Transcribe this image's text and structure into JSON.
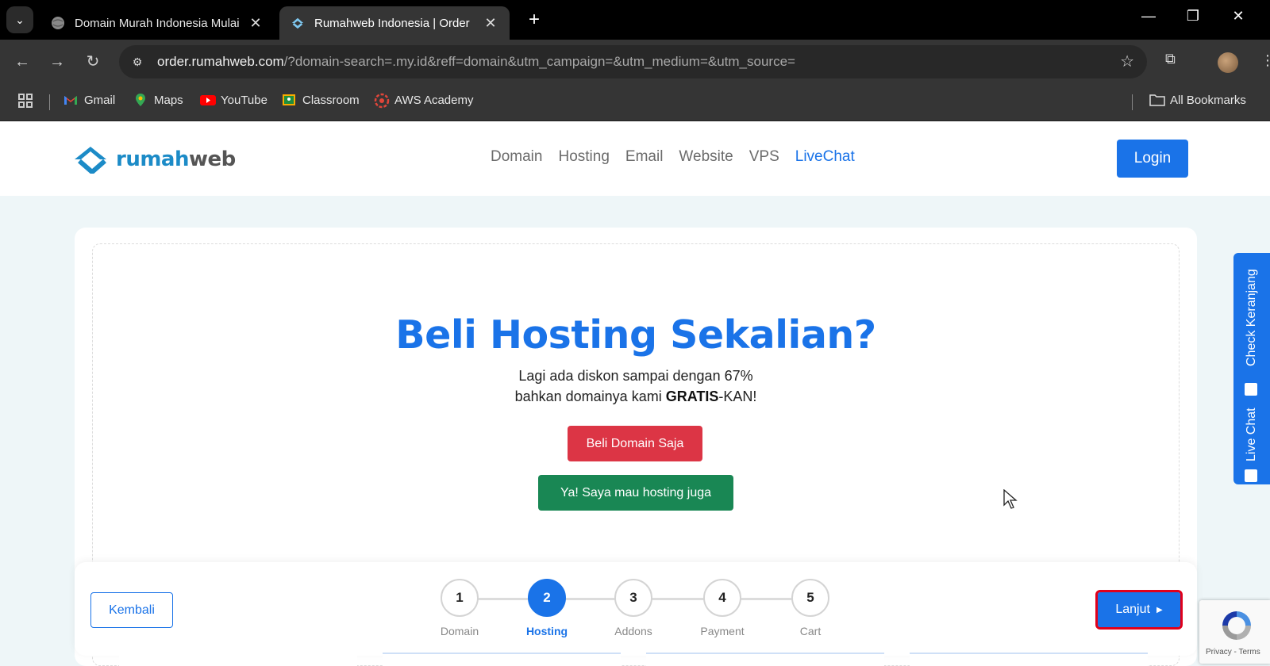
{
  "browser": {
    "tabs": [
      {
        "title": "Domain Murah Indonesia Mulai",
        "active": false
      },
      {
        "title": "Rumahweb Indonesia | Order",
        "active": true
      }
    ],
    "url_host": "order.rumahweb.com",
    "url_rest": "/?domain-search=.my.id&reff=domain&utm_campaign=&utm_medium=&utm_source=",
    "bookmarks": [
      "Gmail",
      "Maps",
      "YouTube",
      "Classroom",
      "AWS Academy"
    ],
    "all_bookmarks": "All Bookmarks"
  },
  "header": {
    "logo_main": "rumah",
    "logo_accent": "web",
    "nav": [
      "Domain",
      "Hosting",
      "Email",
      "Website",
      "VPS",
      "LiveChat"
    ],
    "login_label": "Login"
  },
  "main": {
    "heading": "Beli Hosting Sekalian?",
    "line1": "Lagi ada diskon sampai dengan 67%",
    "line2_pre": "bahkan domainya kami ",
    "line2_bold": "GRATIS",
    "line2_post": "-KAN!",
    "btn_domain_only": "Beli Domain Saja",
    "btn_with_hosting": "Ya! Saya mau hosting juga"
  },
  "stepper": {
    "back_label": "Kembali",
    "next_label": "Lanjut",
    "steps": [
      {
        "num": "1",
        "label": "Domain"
      },
      {
        "num": "2",
        "label": "Hosting"
      },
      {
        "num": "3",
        "label": "Addons"
      },
      {
        "num": "4",
        "label": "Payment"
      },
      {
        "num": "5",
        "label": "Cart"
      }
    ],
    "active_step": 2
  },
  "side_tab": {
    "check_cart": "Check Keranjang",
    "live_chat": "Live Chat"
  },
  "recaptcha": {
    "terms": "Privacy - Terms"
  },
  "colors": {
    "accent": "#1a73e8",
    "red": "#dc3545",
    "green": "#198754",
    "highlight": "#e0001b"
  }
}
